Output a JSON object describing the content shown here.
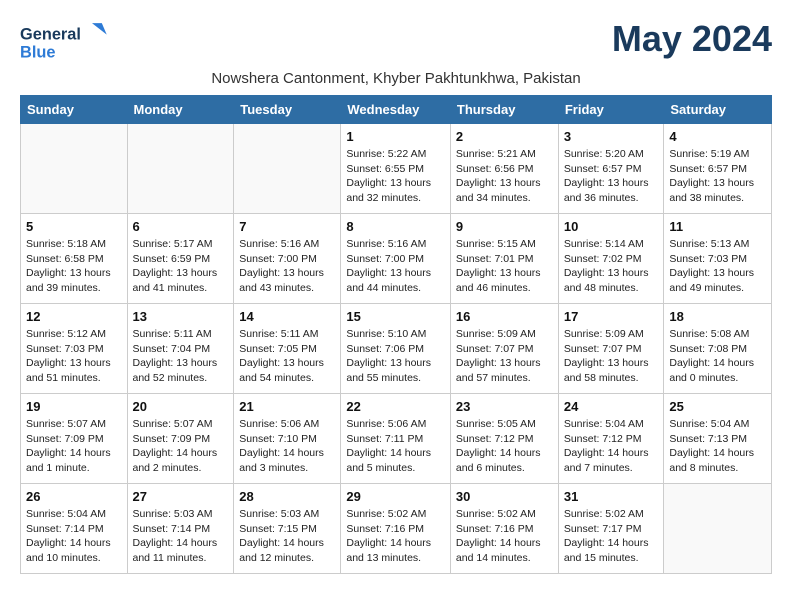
{
  "logo": {
    "general": "General",
    "blue": "Blue"
  },
  "title": "May 2024",
  "subtitle": "Nowshera Cantonment, Khyber Pakhtunkhwa, Pakistan",
  "header": {
    "days": [
      "Sunday",
      "Monday",
      "Tuesday",
      "Wednesday",
      "Thursday",
      "Friday",
      "Saturday"
    ]
  },
  "weeks": [
    [
      {
        "day": "",
        "info": ""
      },
      {
        "day": "",
        "info": ""
      },
      {
        "day": "",
        "info": ""
      },
      {
        "day": "1",
        "info": "Sunrise: 5:22 AM\nSunset: 6:55 PM\nDaylight: 13 hours\nand 32 minutes."
      },
      {
        "day": "2",
        "info": "Sunrise: 5:21 AM\nSunset: 6:56 PM\nDaylight: 13 hours\nand 34 minutes."
      },
      {
        "day": "3",
        "info": "Sunrise: 5:20 AM\nSunset: 6:57 PM\nDaylight: 13 hours\nand 36 minutes."
      },
      {
        "day": "4",
        "info": "Sunrise: 5:19 AM\nSunset: 6:57 PM\nDaylight: 13 hours\nand 38 minutes."
      }
    ],
    [
      {
        "day": "5",
        "info": "Sunrise: 5:18 AM\nSunset: 6:58 PM\nDaylight: 13 hours\nand 39 minutes."
      },
      {
        "day": "6",
        "info": "Sunrise: 5:17 AM\nSunset: 6:59 PM\nDaylight: 13 hours\nand 41 minutes."
      },
      {
        "day": "7",
        "info": "Sunrise: 5:16 AM\nSunset: 7:00 PM\nDaylight: 13 hours\nand 43 minutes."
      },
      {
        "day": "8",
        "info": "Sunrise: 5:16 AM\nSunset: 7:00 PM\nDaylight: 13 hours\nand 44 minutes."
      },
      {
        "day": "9",
        "info": "Sunrise: 5:15 AM\nSunset: 7:01 PM\nDaylight: 13 hours\nand 46 minutes."
      },
      {
        "day": "10",
        "info": "Sunrise: 5:14 AM\nSunset: 7:02 PM\nDaylight: 13 hours\nand 48 minutes."
      },
      {
        "day": "11",
        "info": "Sunrise: 5:13 AM\nSunset: 7:03 PM\nDaylight: 13 hours\nand 49 minutes."
      }
    ],
    [
      {
        "day": "12",
        "info": "Sunrise: 5:12 AM\nSunset: 7:03 PM\nDaylight: 13 hours\nand 51 minutes."
      },
      {
        "day": "13",
        "info": "Sunrise: 5:11 AM\nSunset: 7:04 PM\nDaylight: 13 hours\nand 52 minutes."
      },
      {
        "day": "14",
        "info": "Sunrise: 5:11 AM\nSunset: 7:05 PM\nDaylight: 13 hours\nand 54 minutes."
      },
      {
        "day": "15",
        "info": "Sunrise: 5:10 AM\nSunset: 7:06 PM\nDaylight: 13 hours\nand 55 minutes."
      },
      {
        "day": "16",
        "info": "Sunrise: 5:09 AM\nSunset: 7:07 PM\nDaylight: 13 hours\nand 57 minutes."
      },
      {
        "day": "17",
        "info": "Sunrise: 5:09 AM\nSunset: 7:07 PM\nDaylight: 13 hours\nand 58 minutes."
      },
      {
        "day": "18",
        "info": "Sunrise: 5:08 AM\nSunset: 7:08 PM\nDaylight: 14 hours\nand 0 minutes."
      }
    ],
    [
      {
        "day": "19",
        "info": "Sunrise: 5:07 AM\nSunset: 7:09 PM\nDaylight: 14 hours\nand 1 minute."
      },
      {
        "day": "20",
        "info": "Sunrise: 5:07 AM\nSunset: 7:09 PM\nDaylight: 14 hours\nand 2 minutes."
      },
      {
        "day": "21",
        "info": "Sunrise: 5:06 AM\nSunset: 7:10 PM\nDaylight: 14 hours\nand 3 minutes."
      },
      {
        "day": "22",
        "info": "Sunrise: 5:06 AM\nSunset: 7:11 PM\nDaylight: 14 hours\nand 5 minutes."
      },
      {
        "day": "23",
        "info": "Sunrise: 5:05 AM\nSunset: 7:12 PM\nDaylight: 14 hours\nand 6 minutes."
      },
      {
        "day": "24",
        "info": "Sunrise: 5:04 AM\nSunset: 7:12 PM\nDaylight: 14 hours\nand 7 minutes."
      },
      {
        "day": "25",
        "info": "Sunrise: 5:04 AM\nSunset: 7:13 PM\nDaylight: 14 hours\nand 8 minutes."
      }
    ],
    [
      {
        "day": "26",
        "info": "Sunrise: 5:04 AM\nSunset: 7:14 PM\nDaylight: 14 hours\nand 10 minutes."
      },
      {
        "day": "27",
        "info": "Sunrise: 5:03 AM\nSunset: 7:14 PM\nDaylight: 14 hours\nand 11 minutes."
      },
      {
        "day": "28",
        "info": "Sunrise: 5:03 AM\nSunset: 7:15 PM\nDaylight: 14 hours\nand 12 minutes."
      },
      {
        "day": "29",
        "info": "Sunrise: 5:02 AM\nSunset: 7:16 PM\nDaylight: 14 hours\nand 13 minutes."
      },
      {
        "day": "30",
        "info": "Sunrise: 5:02 AM\nSunset: 7:16 PM\nDaylight: 14 hours\nand 14 minutes."
      },
      {
        "day": "31",
        "info": "Sunrise: 5:02 AM\nSunset: 7:17 PM\nDaylight: 14 hours\nand 15 minutes."
      },
      {
        "day": "",
        "info": ""
      }
    ]
  ]
}
